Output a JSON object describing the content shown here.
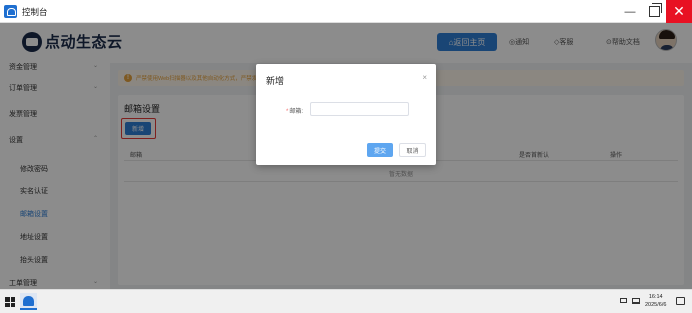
{
  "window": {
    "title": "控制台",
    "minimize_glyph": "—",
    "close_glyph": "✕"
  },
  "header": {
    "logo_text": "点动生态云",
    "home_button": "⌂返回主页",
    "links": [
      {
        "label": "◎通知",
        "icon": "bell-icon"
      },
      {
        "label": "◇客服",
        "icon": "service-icon"
      },
      {
        "label": "⊙帮助文档",
        "icon": "help-icon"
      }
    ]
  },
  "sidebar": {
    "items": [
      {
        "label": "资金管理",
        "level": "top",
        "chevron": "⌄"
      },
      {
        "label": "订单管理",
        "level": "top",
        "chevron": "⌄"
      },
      {
        "label": "发票管理",
        "level": "top",
        "chevron": ""
      },
      {
        "label": "设置",
        "level": "top",
        "chevron": "⌃"
      },
      {
        "label": "修改密码",
        "level": "sub",
        "chevron": ""
      },
      {
        "label": "实名认证",
        "level": "sub",
        "chevron": ""
      },
      {
        "label": "邮箱设置",
        "level": "sub",
        "chevron": "",
        "active": true
      },
      {
        "label": "地址设置",
        "level": "sub",
        "chevron": ""
      },
      {
        "label": "抬头设置",
        "level": "sub",
        "chevron": ""
      },
      {
        "label": "工单管理",
        "level": "top",
        "chevron": "⌄"
      }
    ]
  },
  "main": {
    "notice_icon": "!",
    "notice": "严禁使用Web扫描器以及其他自动化方式，严禁发送",
    "title": "邮箱设置",
    "add_button": "新增",
    "table": {
      "headers": [
        "邮箱",
        "是否首新认",
        "操作"
      ],
      "empty_text": "暂无数据"
    }
  },
  "dialog": {
    "title": "新增",
    "close_glyph": "×",
    "field_required_mark": "*",
    "field_label": "邮箱:",
    "field_value": "",
    "field_placeholder": "",
    "submit_label": "提交",
    "cancel_label": "取消"
  },
  "taskbar": {
    "time": "16:14",
    "date": "2025/6/6"
  },
  "colors": {
    "primary": "#2f7fd6",
    "active_sidebar_text": "#2f7fd6",
    "close_button": "#e81123",
    "highlight_border": "#e53935",
    "notice_text": "#e6a23c"
  }
}
